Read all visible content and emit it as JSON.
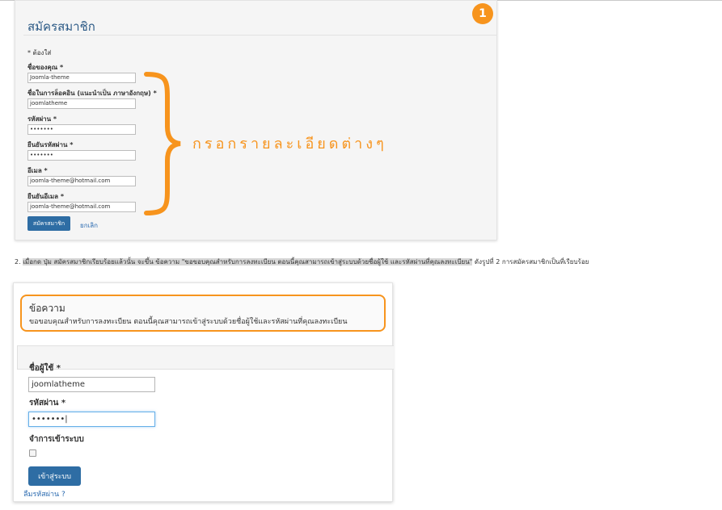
{
  "registration": {
    "heading": "สมัครสมาชิก",
    "badge": "1",
    "required_note": "* ต้องใส่",
    "fields": [
      {
        "label": "ชื่อของคุณ *",
        "value": "Joomla-theme"
      },
      {
        "label": "ชื่อในการล็อคอิน (แนะนำเป็น ภาษาอังกฤษ) *",
        "value": "joomlatheme"
      },
      {
        "label": "รหัสผ่าน *",
        "value": "•••••••"
      },
      {
        "label": "ยืนยันรหัสผ่าน *",
        "value": "•••••••"
      },
      {
        "label": "อีเมล *",
        "value": "joomla-theme@hotmail.com"
      },
      {
        "label": "ยืนยันอีเมล *",
        "value": "joomla-theme@hotmail.com"
      }
    ],
    "submit_label": "สมัครสมาชิก",
    "cancel_label": "ยกเลิก",
    "annotation": "กรอกรายละเอียดต่างๆ"
  },
  "step2": {
    "number": "2.",
    "part1": "เมื่อกด ปุ่ม สมัครสมาชิกเรียบร้อยแล้วนั้น จะขึ้น ข้อความ \"ขอขอบคุณสำหรับการลงทะเบียน ตอนนี้คุณสามารถเข้าสู่ระบบด้วยชื่อผู้ใช้ และรหัสผ่านที่คุณลงทะเบียน\"",
    "part2": " ดังรูปที่ 2 การสมัครสมาชิกเป็นที่เรียบร้อย"
  },
  "login": {
    "message_title": "ข้อความ",
    "message_text": "ขอขอบคุณสำหรับการลงทะเบียน ตอนนี้คุณสามารถเข้าสู่ระบบด้วยชื่อผู้ใช้และรหัสผ่านที่คุณลงทะเบียน",
    "username_label": "ชื่อผู้ใช้ *",
    "username_value": "joomlatheme",
    "password_label": "รหัสผ่าน *",
    "password_value": "•••••••|",
    "remember_label": "จำการเข้าระบบ",
    "login_button": "เข้าสู่ระบบ",
    "forgot_link": "ลืมรหัสผ่าน ?"
  },
  "colors": {
    "accent": "#f7941d",
    "button": "#2e6da4",
    "link": "#2a6ab0"
  }
}
